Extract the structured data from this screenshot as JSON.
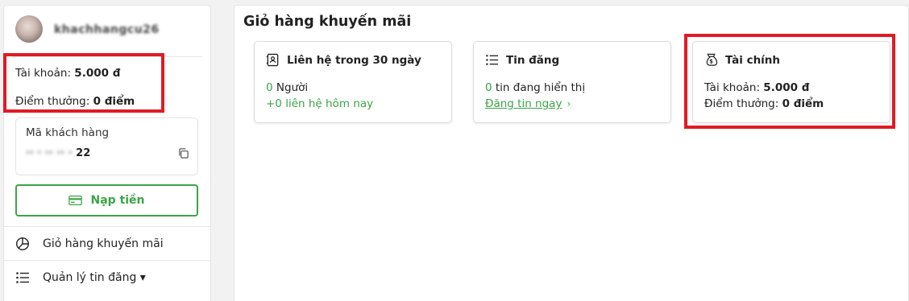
{
  "sidebar": {
    "username": "khachhangcu26",
    "account_label": "Tài khoản:",
    "account_value": "5.000 đ",
    "points_label": "Điểm thưởng:",
    "points_value": "0 điểm",
    "customer_code_title": "Mã khách hàng",
    "customer_code_blurred": "·· · ·· ·· ·",
    "customer_code_suffix": "22",
    "topup_label": "Nạp tiền",
    "nav": [
      {
        "label": "Giỏ hàng khuyến mãi",
        "icon": "pie-chart-icon"
      },
      {
        "label": "Quản lý tin đăng ▾",
        "icon": "list-icon"
      }
    ]
  },
  "main": {
    "title": "Giỏ hàng khuyến mãi",
    "cards": [
      {
        "title": "Liên hệ trong 30 ngày",
        "icon": "contact-book-icon",
        "line1_count": "0",
        "line1_text": " Người",
        "line2": "+0 liên hệ hôm nay"
      },
      {
        "title": "Tin đăng",
        "icon": "list-icon",
        "line1_count": "0",
        "line1_text": " tin đang hiển thị",
        "line2_link": "Đăng tin ngay",
        "line2_chevron": "›"
      },
      {
        "title": "Tài chính",
        "icon": "money-bag-icon",
        "account_label": "Tài khoản:",
        "account_value": "5.000 đ",
        "points_label": "Điểm thưởng:",
        "points_value": "0 điểm"
      }
    ]
  },
  "colors": {
    "accent_green": "#3ba447",
    "highlight_red": "#e01b24"
  }
}
